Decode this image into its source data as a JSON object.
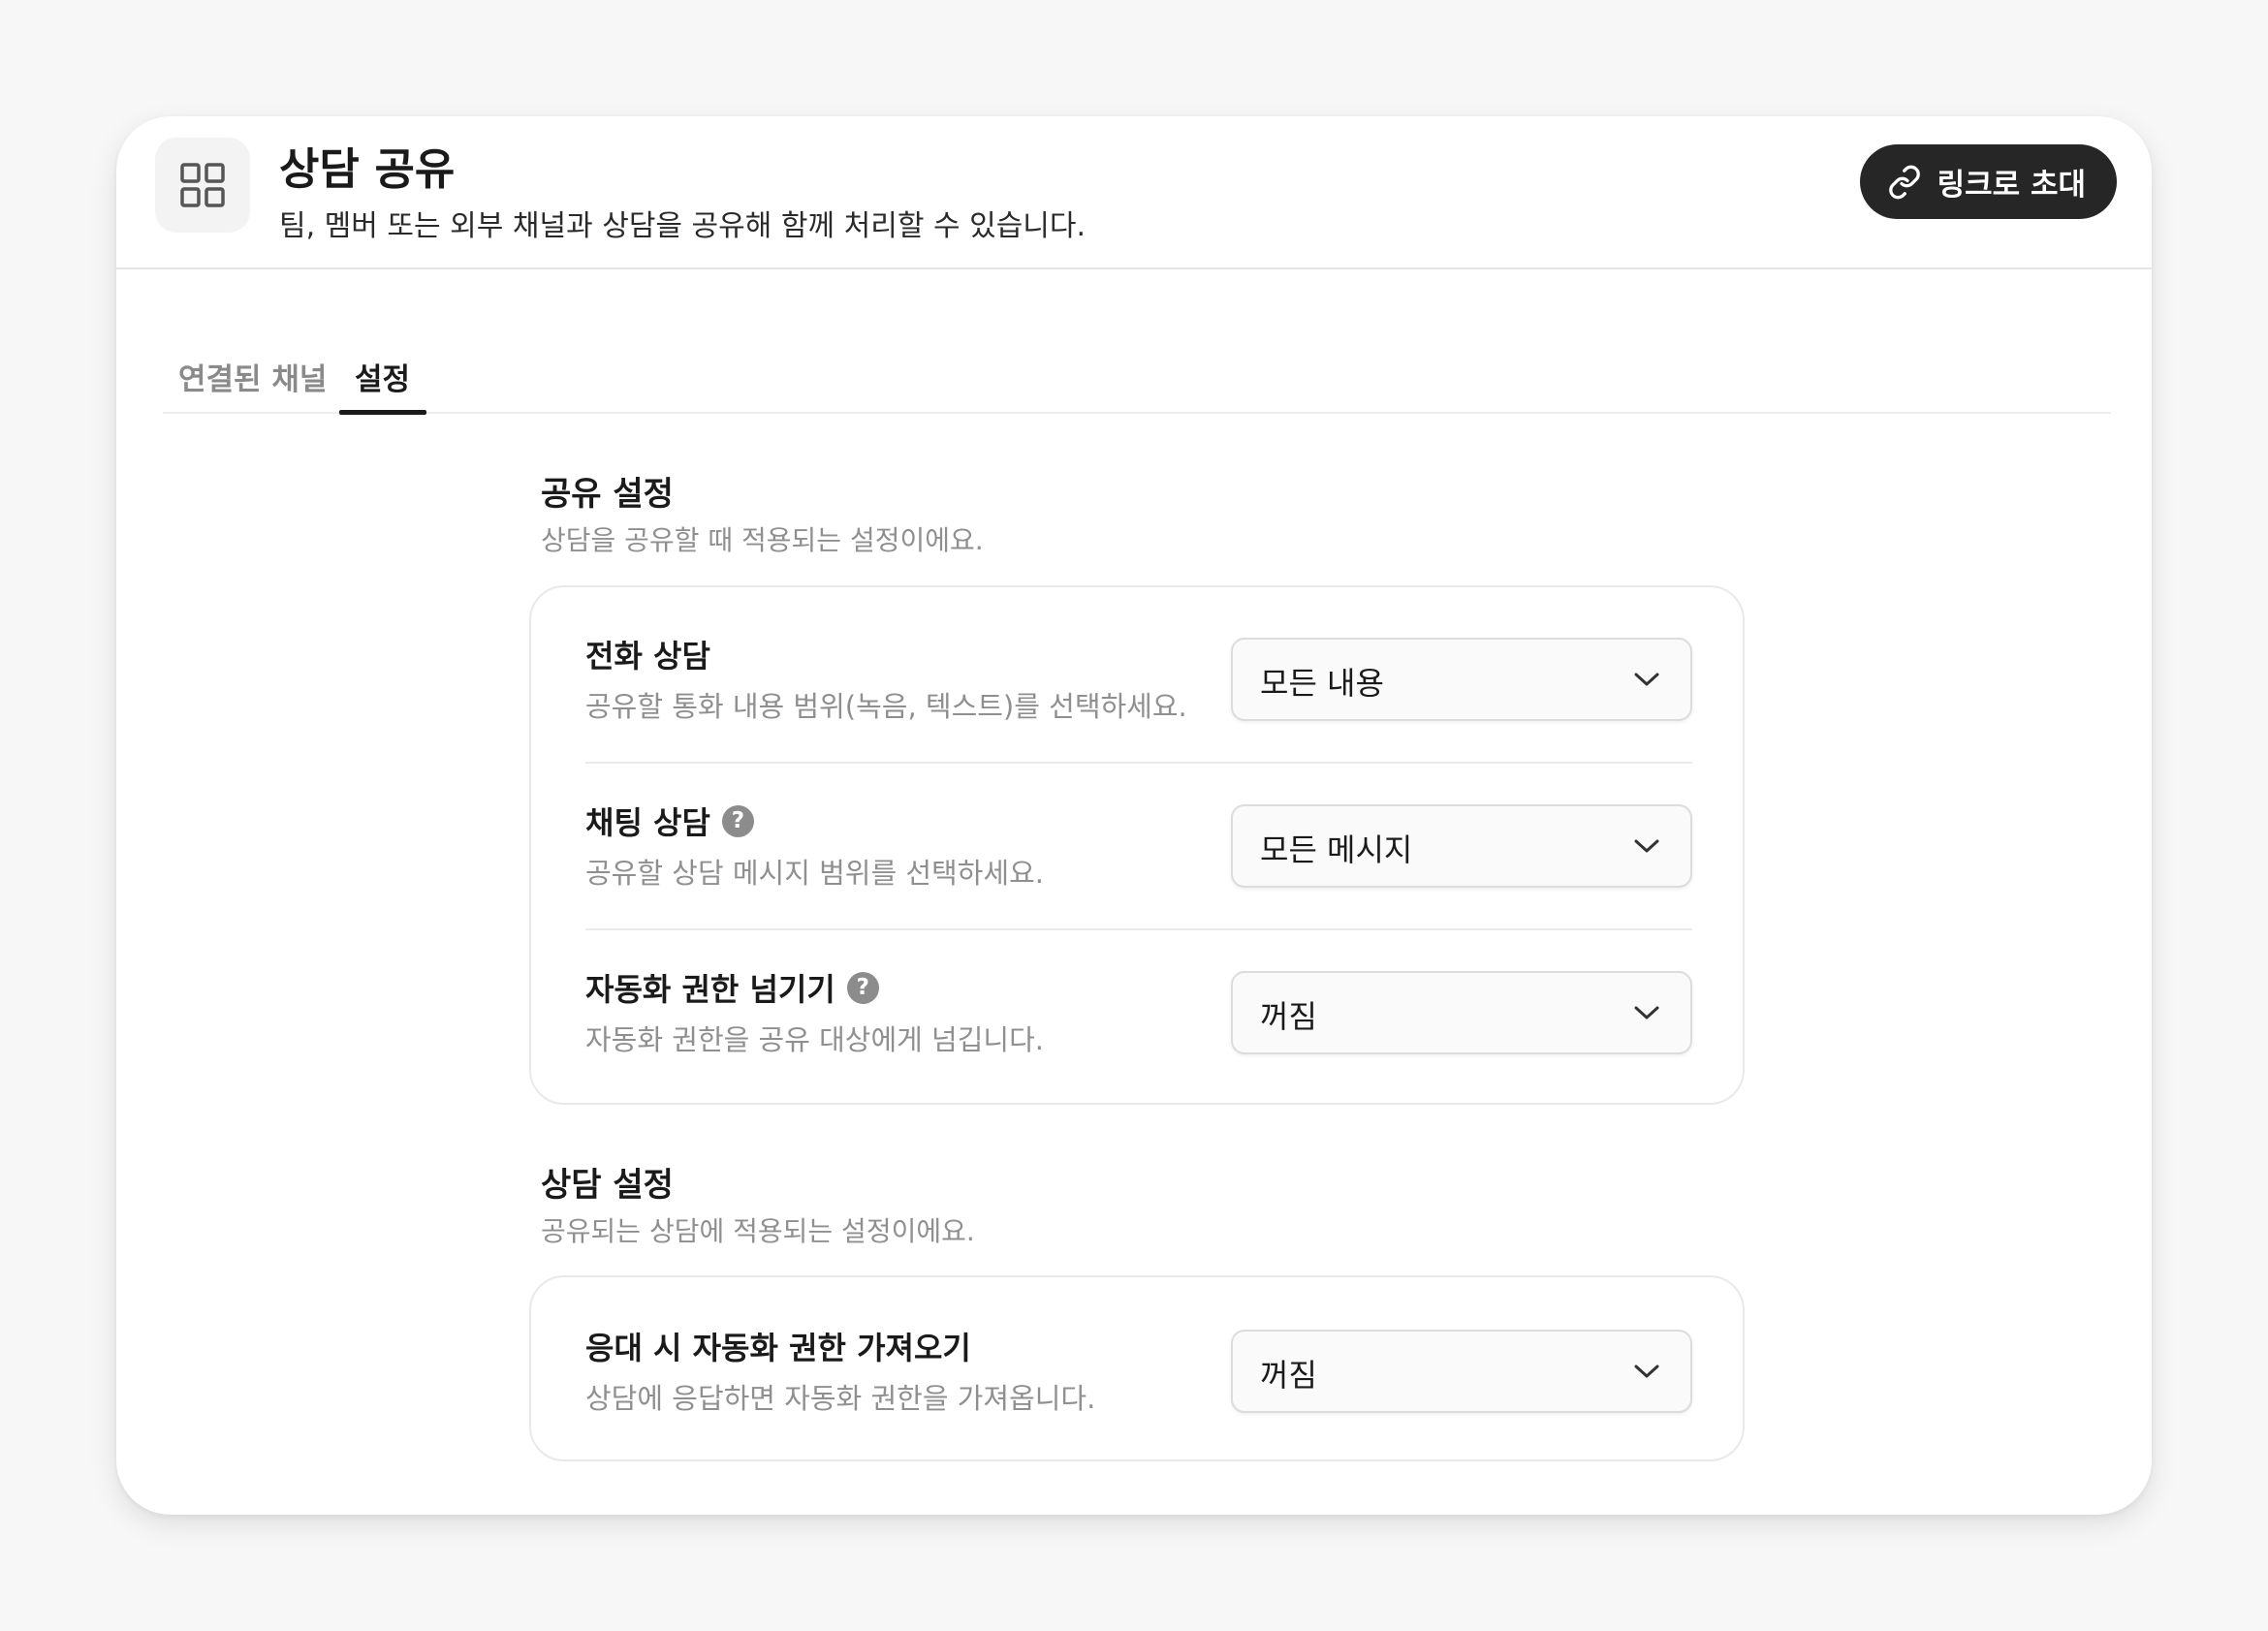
{
  "header": {
    "icon": "grid-icon",
    "title": "상담 공유",
    "subtitle": "팀, 멤버 또는 외부 채널과 상담을 공유해 함께 처리할 수 있습니다.",
    "invite_button": {
      "label": "링크로 초대",
      "icon": "link-icon"
    }
  },
  "tabs": [
    {
      "label": "연결된 채널",
      "active": false
    },
    {
      "label": "설정",
      "active": true
    }
  ],
  "share_settings": {
    "title": "공유 설정",
    "description": "상담을 공유할 때 적용되는 설정이에요.",
    "rows": [
      {
        "label": "전화 상담",
        "description": "공유할 통화 내용 범위(녹음, 텍스트)를 선택하세요.",
        "value": "모든 내용",
        "help": false
      },
      {
        "label": "채팅 상담",
        "description": "공유할 상담 메시지 범위를 선택하세요.",
        "value": "모든 메시지",
        "help": true
      },
      {
        "label": "자동화 권한 넘기기",
        "description": "자동화 권한을 공유 대상에게 넘깁니다.",
        "value": "꺼짐",
        "help": true
      }
    ]
  },
  "consult_settings": {
    "title": "상담 설정",
    "description": "공유되는 상담에 적용되는 설정이에요.",
    "rows": [
      {
        "label": "응대 시 자동화 권한 가져오기",
        "description": "상담에 응답하면 자동화 권한을 가져옵니다.",
        "value": "꺼짐",
        "help": false
      }
    ]
  },
  "help_icon_glyph": "?",
  "colors": {
    "accent_dark": "#262626",
    "muted_text": "#8f8f8f",
    "border": "#e9e9e9"
  }
}
